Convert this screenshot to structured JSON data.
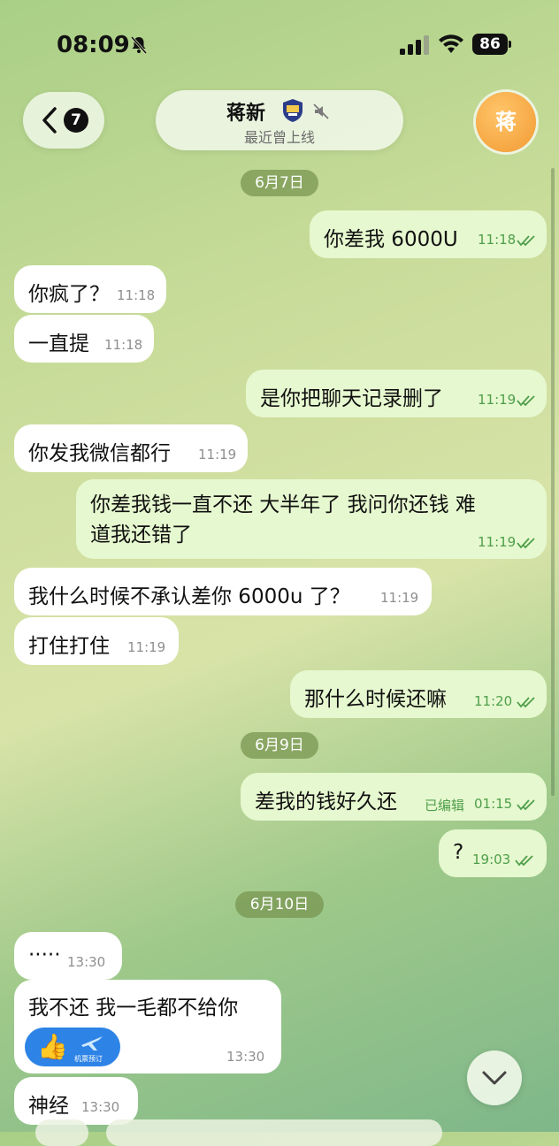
{
  "status_bar": {
    "time": "08:09",
    "battery": "86"
  },
  "header": {
    "back_count": "7",
    "name": "蒋新",
    "status": "最近曾上线",
    "avatar_letter": "蒋"
  },
  "dates": [
    "6月7日",
    "6月9日",
    "6月10日"
  ],
  "messages": [
    {
      "dir": "out",
      "text": "你差我 6000U",
      "time": "11:18"
    },
    {
      "dir": "in",
      "text": "你疯了？",
      "time": "11:18"
    },
    {
      "dir": "in",
      "text": "一直提",
      "time": "11:18"
    },
    {
      "dir": "out",
      "text": "是你把聊天记录删了",
      "time": "11:19"
    },
    {
      "dir": "in",
      "text": "你发我微信都行",
      "time": "11:19"
    },
    {
      "dir": "out",
      "text_line1": "你差我钱一直不还 大半年了 我问你还钱 难",
      "text_line2": "道我还错了",
      "time": "11:19"
    },
    {
      "dir": "in",
      "text": "我什么时候不承认差你 6000u 了？",
      "time": "11:19"
    },
    {
      "dir": "in",
      "text": "打住打住",
      "time": "11:19"
    },
    {
      "dir": "out",
      "text": "那什么时候还嘛",
      "time": "11:20"
    },
    {
      "dir": "out",
      "text": "差我的钱好久还",
      "edited": "已编辑",
      "time": "01:15"
    },
    {
      "dir": "out",
      "text": "?",
      "time": "19:03"
    },
    {
      "dir": "in",
      "text": "·····",
      "time": "13:30"
    },
    {
      "dir": "in",
      "text": "我不还 我一毛都不给你",
      "time": "13:30",
      "sticker_label": "机票预订",
      "thumb": "👍"
    },
    {
      "dir": "in",
      "text": "神经",
      "time": "13:30"
    }
  ],
  "colors": {
    "out_bubble": "#e6f8cf",
    "in_bubble": "#ffffff",
    "date_pill": "#7b9a52",
    "avatar": "#f29a33"
  },
  "icons": [
    "bell-off-icon",
    "signal-icon",
    "wifi-icon",
    "back-chevron-icon",
    "badge-icon",
    "mute-icon",
    "double-check-icon",
    "thumbs-up-icon",
    "plane-icon",
    "chevron-down-icon"
  ]
}
